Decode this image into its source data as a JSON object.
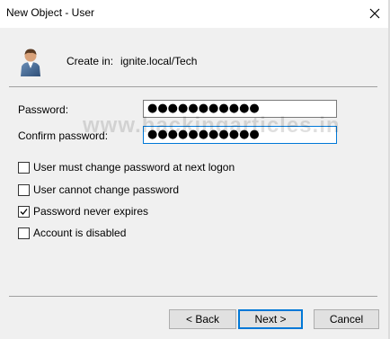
{
  "window": {
    "title": "New Object - User",
    "close_icon": "close-icon"
  },
  "header": {
    "icon": "user-icon",
    "create_in_label": "Create in:",
    "create_in_value": "ignite.local/Tech"
  },
  "form": {
    "password_label": "Password:",
    "password_value": "●●●●●●●●●●●",
    "confirm_password_label": "Confirm password:",
    "confirm_password_value": "●●●●●●●●●●●"
  },
  "options": [
    {
      "label": "User must change password at next logon",
      "checked": false
    },
    {
      "label": "User cannot change password",
      "checked": false
    },
    {
      "label": "Password never expires",
      "checked": true
    },
    {
      "label": "Account is disabled",
      "checked": false
    }
  ],
  "buttons": {
    "back": "< Back",
    "next": "Next >",
    "cancel": "Cancel"
  },
  "watermark": "www.hackingarticles.in",
  "colors": {
    "accent": "#0078d7",
    "dialog_bg": "#f0f0f0",
    "title_bg": "#ffffff"
  }
}
